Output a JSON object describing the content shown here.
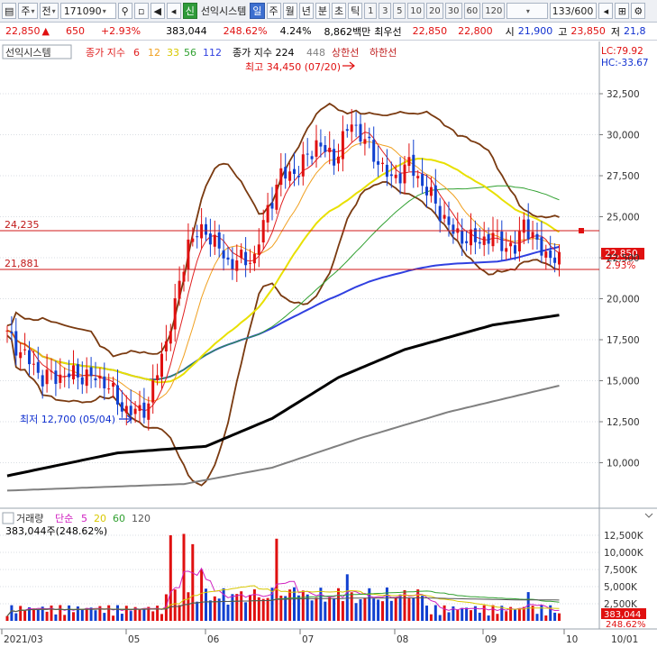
{
  "toolbar": {
    "market_label": "주",
    "type_label": "전",
    "code_value": "171090",
    "name_badge": "신",
    "name_value": "선익시스템",
    "periods": [
      "일",
      "주",
      "월",
      "년",
      "분",
      "초",
      "틱"
    ],
    "active_period": "일",
    "minutes": [
      "1",
      "3",
      "5",
      "10",
      "20",
      "30",
      "60",
      "120"
    ],
    "count_value": "133/600"
  },
  "infobar": {
    "price": "22,850",
    "change": "650",
    "change_rate": "+2.93%",
    "volume": "383,044",
    "volume_rate": "248.62%",
    "turnover": "4.24%",
    "amount": "8,862백만",
    "best_sell_label": "최우선",
    "best_sell": "22,850",
    "best_buy": "22,800",
    "open_label": "시",
    "open": "21,900",
    "high_label": "고",
    "high": "23,850",
    "low_label": "저",
    "low": "21,8"
  },
  "price_panel": {
    "name": "선익시스템",
    "ma_label": "종가 지수",
    "ma_values": [
      "6",
      "12",
      "33",
      "56",
      "112"
    ],
    "ma_colors": [
      "#e02020",
      "#f0a020",
      "#e8e000",
      "#30a030",
      "#3040e0"
    ],
    "ma2_label": "종가 지수 224",
    "ma2_value": "448",
    "upper_label": "상한선",
    "lower_label": "하한선",
    "lc": "LC:79.92",
    "hc": "HC:-33.67",
    "high_note": "최고 34,450 (07/20)",
    "low_note": "최저 12,700 (05/04)",
    "line1": "24,235",
    "line2": "21,881",
    "current_price": "22,850",
    "current_rate": "2.93%",
    "y_ticks": [
      "32,500",
      "30,000",
      "27,500",
      "25,000",
      "22,500",
      "20,000",
      "17,500",
      "15,000",
      "12,500",
      "10,000"
    ]
  },
  "volume_panel": {
    "label": "거래량",
    "ma_label": "단순",
    "ma_values": [
      "5",
      "20",
      "60",
      "120"
    ],
    "value": "383,044주(248.62%)",
    "current": "383,044",
    "current_rate": "248.62%",
    "y_ticks": [
      "12,500K",
      "10,000K",
      "7,500K",
      "5,000K",
      "2,500K"
    ]
  },
  "x_axis": [
    "2021/03",
    "05",
    "06",
    "07",
    "08",
    "09",
    "10",
    "10/01"
  ],
  "colors": {
    "up": "#e01010",
    "down": "#1040d0",
    "bollinger": "#7a3a10",
    "ma224": "#000000",
    "ma448": "#808080",
    "grid": "#d9dde3"
  },
  "chart_data": {
    "type": "candlestick",
    "anchors": [
      {
        "idx": 0,
        "close": 17800
      },
      {
        "idx": 8,
        "close": 15200
      },
      {
        "idx": 16,
        "close": 15400
      },
      {
        "idx": 22,
        "close": 15000
      },
      {
        "idx": 26,
        "close": 13400
      },
      {
        "idx": 29,
        "close": 13000
      },
      {
        "idx": 32,
        "close": 13600
      },
      {
        "idx": 35,
        "close": 16500
      },
      {
        "idx": 38,
        "close": 19500
      },
      {
        "idx": 41,
        "close": 23500
      },
      {
        "idx": 45,
        "close": 24200
      },
      {
        "idx": 50,
        "close": 22200
      },
      {
        "idx": 56,
        "close": 22500
      },
      {
        "idx": 59,
        "close": 25500
      },
      {
        "idx": 62,
        "close": 27500
      },
      {
        "idx": 66,
        "close": 27800
      },
      {
        "idx": 70,
        "close": 29500
      },
      {
        "idx": 74,
        "close": 28500
      },
      {
        "idx": 78,
        "close": 30800
      },
      {
        "idx": 82,
        "close": 29200
      },
      {
        "idx": 87,
        "close": 27200
      },
      {
        "idx": 91,
        "close": 28200
      },
      {
        "idx": 96,
        "close": 26200
      },
      {
        "idx": 101,
        "close": 24000
      },
      {
        "idx": 106,
        "close": 23500
      },
      {
        "idx": 110,
        "close": 23800
      },
      {
        "idx": 115,
        "close": 22900
      },
      {
        "idx": 117,
        "close": 24800
      },
      {
        "idx": 120,
        "close": 23200
      },
      {
        "idx": 124,
        "close": 22400
      },
      {
        "idx": 125,
        "close": 22850
      }
    ],
    "ma224": [
      [
        0,
        9200
      ],
      [
        25,
        10600
      ],
      [
        45,
        11000
      ],
      [
        60,
        12700
      ],
      [
        75,
        15200
      ],
      [
        90,
        16900
      ],
      [
        110,
        18400
      ],
      [
        125,
        19000
      ]
    ],
    "ma448": [
      [
        0,
        8300
      ],
      [
        40,
        8700
      ],
      [
        60,
        9700
      ],
      [
        80,
        11500
      ],
      [
        100,
        13100
      ],
      [
        125,
        14700
      ]
    ],
    "ylim": [
      8000,
      34500
    ]
  }
}
